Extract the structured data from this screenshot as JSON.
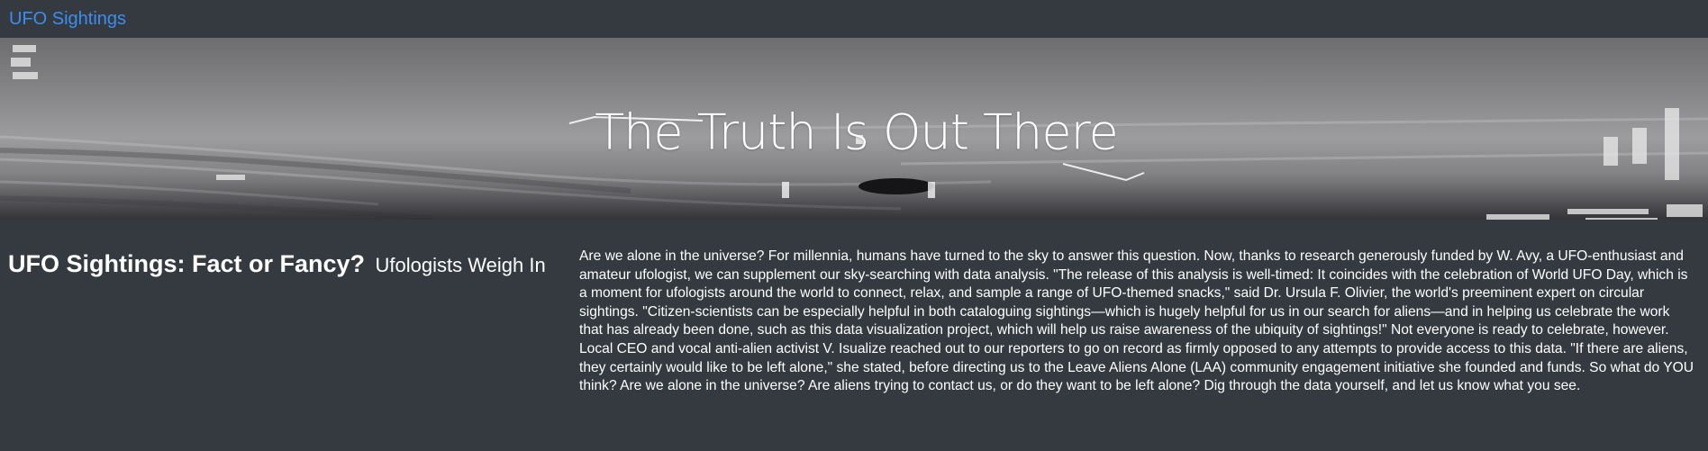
{
  "navbar": {
    "brand": "UFO Sightings"
  },
  "hero": {
    "title": "The Truth Is Out There",
    "image": "ufo-infrared-footage"
  },
  "main": {
    "headline": "UFO Sightings: Fact or Fancy?",
    "subheadline": "Ufologists Weigh In",
    "article": "Are we alone in the universe? For millennia, humans have turned to the sky to answer this question. Now, thanks to research generously funded by W. Avy, a UFO-enthusiast and amateur ufologist, we can supplement our sky-searching with data analysis. \"The release of this analysis is well-timed: It coincides with the celebration of World UFO Day, which is a moment for ufologists around the world to connect, relax, and sample a range of UFO-themed snacks,\" said Dr. Ursula F. Olivier, the world's preeminent expert on circular sightings. \"Citizen-scientists can be especially helpful in both cataloguing sightings—which is hugely helpful for us in our search for aliens—and in helping us celebrate the work that has already been done, such as this data visualization project, which will help us raise awareness of the ubiquity of sightings!\" Not everyone is ready to celebrate, however. Local CEO and vocal anti-alien activist V. Isualize reached out to our reporters to go on record as firmly opposed to any attempts to provide access to this data. \"If there are aliens, they certainly would like to be left alone,\" she stated, before directing us to the Leave Aliens Alone (LAA) community engagement initiative she founded and funds. So what do YOU think? Are we alone in the universe? Are aliens trying to contact us, or do they want to be left alone? Dig through the data yourself, and let us know what you see."
  },
  "colors": {
    "background": "#343a40",
    "brand": "#3b8ef0",
    "text": "#ffffff"
  }
}
